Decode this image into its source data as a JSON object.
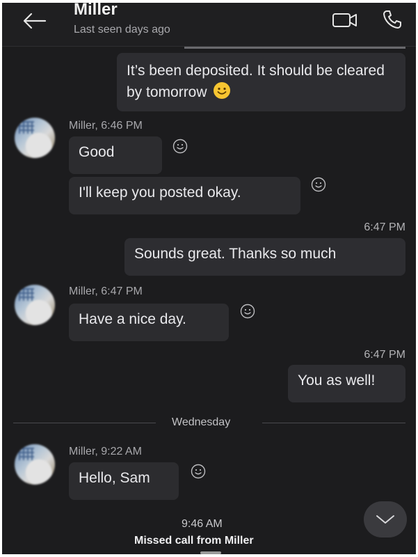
{
  "header": {
    "title": "Miller",
    "subtitle": "Last seen days ago",
    "icons": {
      "back": "arrow-left-icon",
      "video": "video-camera-icon",
      "call": "phone-icon"
    }
  },
  "messages": {
    "m1": {
      "text": "It’s been deposited. It should be cleared by tomorrow",
      "emoji": "smiling-face-emoji"
    },
    "g1": {
      "sender": "Miller, 6:46 PM",
      "m2": "Good",
      "m3": "I'll keep you posted okay."
    },
    "t1": "6:47 PM",
    "m4": "Sounds great. Thanks so much",
    "g2": {
      "sender": "Miller, 6:47 PM",
      "m5": "Have a nice day."
    },
    "t2": "6:47 PM",
    "m6": "You as well!",
    "day_divider": "Wednesday",
    "g3": {
      "sender": "Miller, 9:22 AM",
      "m7": "Hello, Sam"
    },
    "t3": "9:46 AM",
    "missed_call": "Missed call from Miller"
  },
  "colors": {
    "background": "#1c1c1e",
    "bubble": "#2c2c2f",
    "text": "#e9e9ec",
    "muted": "#a8a8ac"
  }
}
